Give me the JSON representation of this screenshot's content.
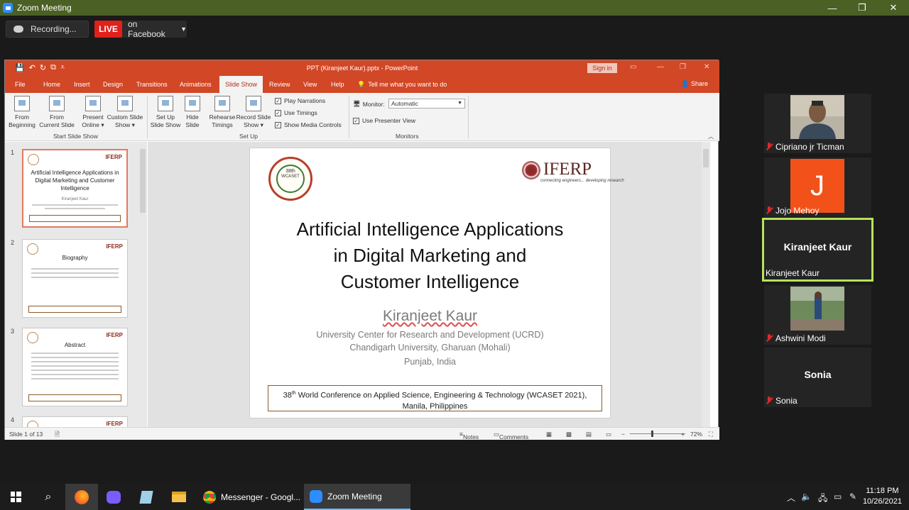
{
  "zoom": {
    "window_title": "Zoom Meeting",
    "recording_label": "Recording...",
    "live_label": "LIVE",
    "live_destination": "on Facebook",
    "window_controls": {
      "minimize": "—",
      "maximize": "❐",
      "close": "✕"
    }
  },
  "ppt": {
    "title": "PPT (Kiranjeet Kaur).pptx  -  PowerPoint",
    "sign_in": "Sign in",
    "share": "Share",
    "tell_me": "Tell me what you want to do",
    "tabs": [
      "File",
      "Home",
      "Insert",
      "Design",
      "Transitions",
      "Animations",
      "Slide Show",
      "Review",
      "View",
      "Help"
    ],
    "active_tab": "Slide Show",
    "ribbon": {
      "buttons": [
        {
          "label1": "From",
          "label2": "Beginning"
        },
        {
          "label1": "From",
          "label2": "Current Slide"
        },
        {
          "label1": "Present",
          "label2": "Online ▾"
        },
        {
          "label1": "Custom Slide",
          "label2": "Show ▾"
        },
        {
          "label1": "Set Up",
          "label2": "Slide Show"
        },
        {
          "label1": "Hide",
          "label2": "Slide"
        },
        {
          "label1": "Rehearse",
          "label2": "Timings"
        },
        {
          "label1": "Record Slide",
          "label2": "Show ▾"
        }
      ],
      "checkboxes": [
        "Play Narrations",
        "Use Timings",
        "Show Media Controls"
      ],
      "monitor_label": "Monitor:",
      "monitor_value": "Automatic",
      "presenter_view": "Use Presenter View",
      "groups": [
        "Start Slide Show",
        "Set Up",
        "Monitors"
      ]
    },
    "thumbnails": [
      {
        "num": "1",
        "title": "Artificial Intelligence Applications in Digital Marketing and Customer Intelligence",
        "sub": "Kiranjeet Kaur"
      },
      {
        "num": "2",
        "title": "Biography"
      },
      {
        "num": "3",
        "title": "Abstract"
      },
      {
        "num": "4",
        "title": ""
      }
    ],
    "slide": {
      "seal_line1": "38th",
      "seal_line2": "WCASET",
      "brand": "IFERP",
      "brand_tag": "connecting engineers... developing research",
      "title_line1": "Artificial Intelligence Applications",
      "title_line2": "in Digital Marketing and",
      "title_line3": "Customer Intelligence",
      "author": "Kiranjeet Kaur",
      "aff1": "University Center for Research and Development (UCRD)",
      "aff2": "Chandigarh University,  Gharuan (Mohali)",
      "aff3": "Punjab, India",
      "footer_num": "38",
      "footer_sup": "th",
      "footer_line1": " World Conference on Applied Science, Engineering & Technology (WCASET 2021),",
      "footer_line2": "Manila, Philippines"
    },
    "status": {
      "slide_of": "Slide 1 of 13",
      "notes": "Notes",
      "comments": "Comments",
      "zoom": "72%"
    }
  },
  "participants": [
    {
      "name": "Cipriano jr Ticman",
      "muted": true
    },
    {
      "name": "Jojo Mehoy",
      "initial": "J",
      "muted": true
    },
    {
      "name": "Kiranjeet Kaur",
      "center_name": "Kiranjeet Kaur",
      "muted": false
    },
    {
      "name": "Ashwini Modi",
      "muted": true
    },
    {
      "name": "Sonia",
      "center_name": "Sonia",
      "muted": true
    }
  ],
  "taskbar": {
    "apps": [
      "Messenger - Googl...",
      "Zoom Meeting"
    ],
    "time": "11:18 PM",
    "date": "10/26/2021"
  },
  "colors": {
    "ppt_accent": "#d24726",
    "zoom_titlebar": "#4a6024",
    "live_red": "#e0201b",
    "speaker_border": "#b7e35a"
  }
}
